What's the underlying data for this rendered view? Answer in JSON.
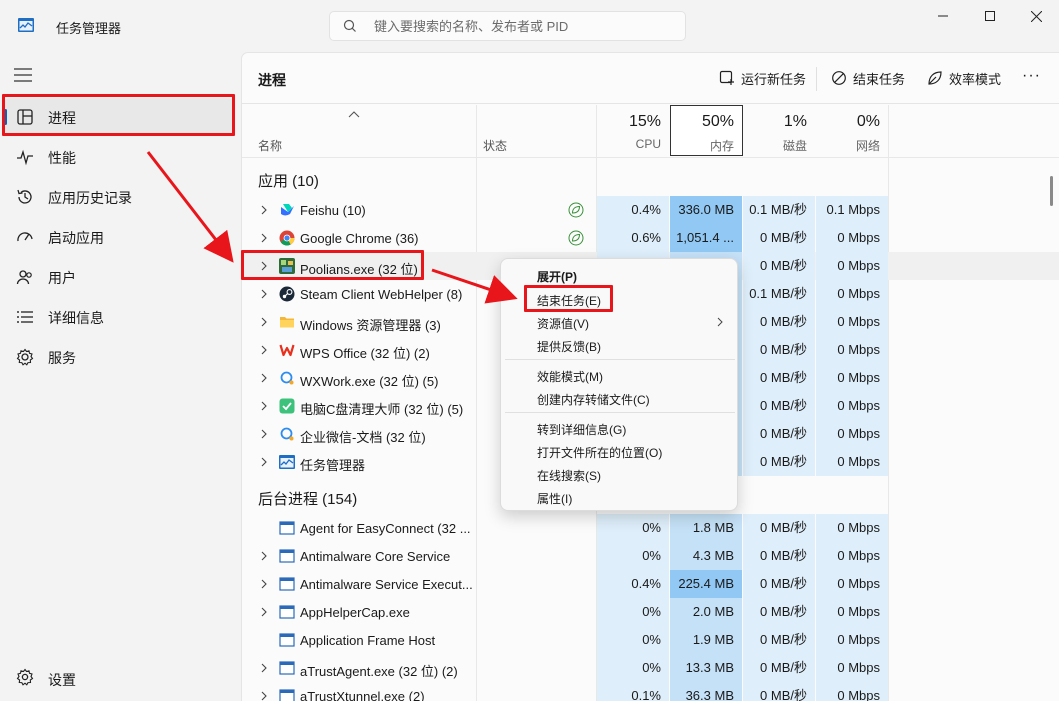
{
  "app": {
    "title": "任务管理器"
  },
  "search": {
    "placeholder": "键入要搜索的名称、发布者或 PID"
  },
  "sidebar": {
    "items": [
      {
        "label": "进程",
        "icon": "processes-icon"
      },
      {
        "label": "性能",
        "icon": "performance-icon"
      },
      {
        "label": "应用历史记录",
        "icon": "history-icon"
      },
      {
        "label": "启动应用",
        "icon": "startup-icon"
      },
      {
        "label": "用户",
        "icon": "users-icon"
      },
      {
        "label": "详细信息",
        "icon": "details-icon"
      },
      {
        "label": "服务",
        "icon": "services-icon"
      }
    ],
    "settings_label": "设置"
  },
  "toolbar": {
    "page_title": "进程",
    "run_new_task": "运行新任务",
    "end_task": "结束任务",
    "efficiency_mode": "效率模式",
    "more": "···"
  },
  "columns": {
    "name": "名称",
    "status": "状态",
    "cpu": {
      "pct": "15%",
      "label": "CPU"
    },
    "memory": {
      "pct": "50%",
      "label": "内存"
    },
    "disk": {
      "pct": "1%",
      "label": "磁盘"
    },
    "network": {
      "pct": "0%",
      "label": "网络"
    }
  },
  "groups": {
    "apps": "应用 (10)",
    "background": "后台进程 (154)"
  },
  "apps": [
    {
      "name": "Feishu (10)",
      "cpu": "0.4%",
      "mem": "336.0 MB",
      "disk": "0.1 MB/秒",
      "net": "0.1 Mbps"
    },
    {
      "name": "Google Chrome (36)",
      "cpu": "0.6%",
      "mem": "1,051.4 ...",
      "disk": "0 MB/秒",
      "net": "0 Mbps"
    },
    {
      "name": "Poolians.exe (32 位)",
      "cpu": "",
      "mem": "",
      "disk": "0 MB/秒",
      "net": "0 Mbps"
    },
    {
      "name": "Steam Client WebHelper (8)",
      "cpu": "",
      "mem": "",
      "disk": "0.1 MB/秒",
      "net": "0 Mbps"
    },
    {
      "name": "Windows 资源管理器 (3)",
      "cpu": "",
      "mem": "",
      "disk": "0 MB/秒",
      "net": "0 Mbps"
    },
    {
      "name": "WPS Office (32 位) (2)",
      "cpu": "",
      "mem": "",
      "disk": "0 MB/秒",
      "net": "0 Mbps"
    },
    {
      "name": "WXWork.exe (32 位) (5)",
      "cpu": "",
      "mem": "",
      "disk": "0 MB/秒",
      "net": "0 Mbps"
    },
    {
      "name": "电脑C盘清理大师 (32 位) (5)",
      "cpu": "",
      "mem": "",
      "disk": "0 MB/秒",
      "net": "0 Mbps"
    },
    {
      "name": "企业微信-文档 (32 位)",
      "cpu": "",
      "mem": "",
      "disk": "0 MB/秒",
      "net": "0 Mbps"
    },
    {
      "name": "任务管理器",
      "cpu": "",
      "mem": "",
      "disk": "0 MB/秒",
      "net": "0 Mbps"
    }
  ],
  "background": [
    {
      "name": "Agent for EasyConnect (32 ...",
      "cpu": "0%",
      "mem": "1.8 MB",
      "disk": "0 MB/秒",
      "net": "0 Mbps"
    },
    {
      "name": "Antimalware Core Service",
      "cpu": "0%",
      "mem": "4.3 MB",
      "disk": "0 MB/秒",
      "net": "0 Mbps"
    },
    {
      "name": "Antimalware Service Execut...",
      "cpu": "0.4%",
      "mem": "225.4 MB",
      "disk": "0 MB/秒",
      "net": "0 Mbps"
    },
    {
      "name": "AppHelperCap.exe",
      "cpu": "0%",
      "mem": "2.0 MB",
      "disk": "0 MB/秒",
      "net": "0 Mbps"
    },
    {
      "name": "Application Frame Host",
      "cpu": "0%",
      "mem": "1.9 MB",
      "disk": "0 MB/秒",
      "net": "0 Mbps"
    },
    {
      "name": "aTrustAgent.exe (32 位) (2)",
      "cpu": "0%",
      "mem": "13.3 MB",
      "disk": "0 MB/秒",
      "net": "0 Mbps"
    },
    {
      "name": "aTrustXtunnel.exe (2)",
      "cpu": "0.1%",
      "mem": "36.3 MB",
      "disk": "0 MB/秒",
      "net": "0 Mbps"
    }
  ],
  "context_menu": {
    "expand": "展开(P)",
    "end_task": "结束任务(E)",
    "resource_values": "资源值(V)",
    "feedback": "提供反馈(B)",
    "efficiency_mode": "效能模式(M)",
    "create_dump": "创建内存转储文件(C)",
    "go_to_details": "转到详细信息(G)",
    "open_file_location": "打开文件所在的位置(O)",
    "search_online": "在线搜索(S)",
    "properties": "属性(I)"
  },
  "colors": {
    "accent": "#0067c0",
    "highlight_red": "#e8151b",
    "heat_low": "#deeefa",
    "heat_mid": "#c5e1f7",
    "heat_high": "#91c8f4"
  }
}
